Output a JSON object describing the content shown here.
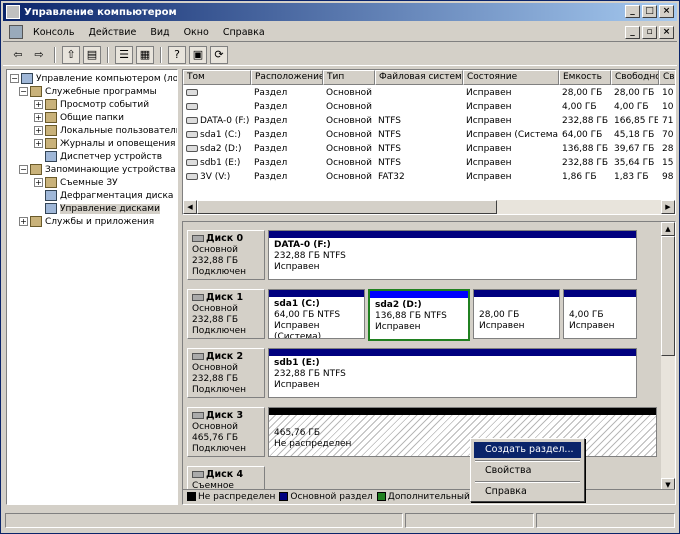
{
  "window": {
    "title": "Управление компьютером"
  },
  "menu": [
    "Консоль",
    "Действие",
    "Вид",
    "Окно",
    "Справка"
  ],
  "tree": [
    {
      "label": "Управление компьютером (локаль",
      "level": 0,
      "pm": "-"
    },
    {
      "label": "Служебные программы",
      "level": 1,
      "pm": "-"
    },
    {
      "label": "Просмотр событий",
      "level": 2,
      "pm": "+"
    },
    {
      "label": "Общие папки",
      "level": 2,
      "pm": "+"
    },
    {
      "label": "Локальные пользователи",
      "level": 2,
      "pm": "+"
    },
    {
      "label": "Журналы и оповещения пр",
      "level": 2,
      "pm": "+"
    },
    {
      "label": "Диспетчер устройств",
      "level": 2,
      "pm": ""
    },
    {
      "label": "Запоминающие устройства",
      "level": 1,
      "pm": "-"
    },
    {
      "label": "Съемные ЗУ",
      "level": 2,
      "pm": "+"
    },
    {
      "label": "Дефрагментация диска",
      "level": 2,
      "pm": ""
    },
    {
      "label": "Управление дисками",
      "level": 2,
      "pm": "",
      "selected": true
    },
    {
      "label": "Службы и приложения",
      "level": 1,
      "pm": "+"
    }
  ],
  "volumes": {
    "columns": [
      "Том",
      "Расположение",
      "Тип",
      "Файловая система",
      "Состояние",
      "Емкость",
      "Свободно",
      "Сво"
    ],
    "rows": [
      [
        "",
        "Раздел",
        "Основной",
        "",
        "Исправен",
        "28,00 ГБ",
        "28,00 ГБ",
        "10"
      ],
      [
        "",
        "Раздел",
        "Основной",
        "",
        "Исправен",
        "4,00 ГБ",
        "4,00 ГБ",
        "10"
      ],
      [
        "DATA-0 (F:)",
        "Раздел",
        "Основной",
        "NTFS",
        "Исправен",
        "232,88 ГБ",
        "166,85 ГБ",
        "71"
      ],
      [
        "sda1 (C:)",
        "Раздел",
        "Основной",
        "NTFS",
        "Исправен (Система)",
        "64,00 ГБ",
        "45,18 ГБ",
        "70"
      ],
      [
        "sda2 (D:)",
        "Раздел",
        "Основной",
        "NTFS",
        "Исправен",
        "136,88 ГБ",
        "39,67 ГБ",
        "28"
      ],
      [
        "sdb1 (E:)",
        "Раздел",
        "Основной",
        "NTFS",
        "Исправен",
        "232,88 ГБ",
        "35,64 ГБ",
        "15"
      ],
      [
        "3V (V:)",
        "Раздел",
        "Основной",
        "FAT32",
        "Исправен",
        "1,86 ГБ",
        "1,83 ГБ",
        "98"
      ]
    ]
  },
  "disks": [
    {
      "name": "Диск 0",
      "type": "Основной",
      "size": "232,88 ГБ",
      "status": "Подключен"
    },
    {
      "name": "Диск 1",
      "type": "Основной",
      "size": "232,88 ГБ",
      "status": "Подключен"
    },
    {
      "name": "Диск 2",
      "type": "Основной",
      "size": "232,88 ГБ",
      "status": "Подключен"
    },
    {
      "name": "Диск 3",
      "type": "Основной",
      "size": "465,76 ГБ",
      "status": "Подключен"
    },
    {
      "name": "Диск 4",
      "type": "Съемное устрой"
    }
  ],
  "partitions": {
    "d0p1": {
      "name": "DATA-0 (F:)",
      "info": "232,88 ГБ NTFS",
      "status": "Исправен"
    },
    "d1p1": {
      "name": "sda1 (C:)",
      "info": "64,00 ГБ NTFS",
      "status": "Исправен (Система)"
    },
    "d1p2": {
      "name": "sda2 (D:)",
      "info": "136,88 ГБ NTFS",
      "status": "Исправен"
    },
    "d1p3": {
      "info": "28,00 ГБ",
      "status": "Исправен"
    },
    "d1p4": {
      "info": "4,00 ГБ",
      "status": "Исправен"
    },
    "d2p1": {
      "name": "sdb1 (E:)",
      "info": "232,88 ГБ NTFS",
      "status": "Исправен"
    },
    "d3p1": {
      "info": "465,76 ГБ",
      "status": "Не распределен"
    }
  },
  "legend": [
    {
      "label": "Не распределен",
      "color": "#000000"
    },
    {
      "label": "Основной раздел",
      "color": "#00007f"
    },
    {
      "label": "Дополнительный разд",
      "color": "#208020"
    }
  ],
  "context_menu": [
    "Создать раздел...",
    "Свойства",
    "Справка"
  ],
  "colors": {
    "primary": "#00007f",
    "unallocated": "#000000",
    "selected": "#208020",
    "highlight": "#0a246a"
  }
}
